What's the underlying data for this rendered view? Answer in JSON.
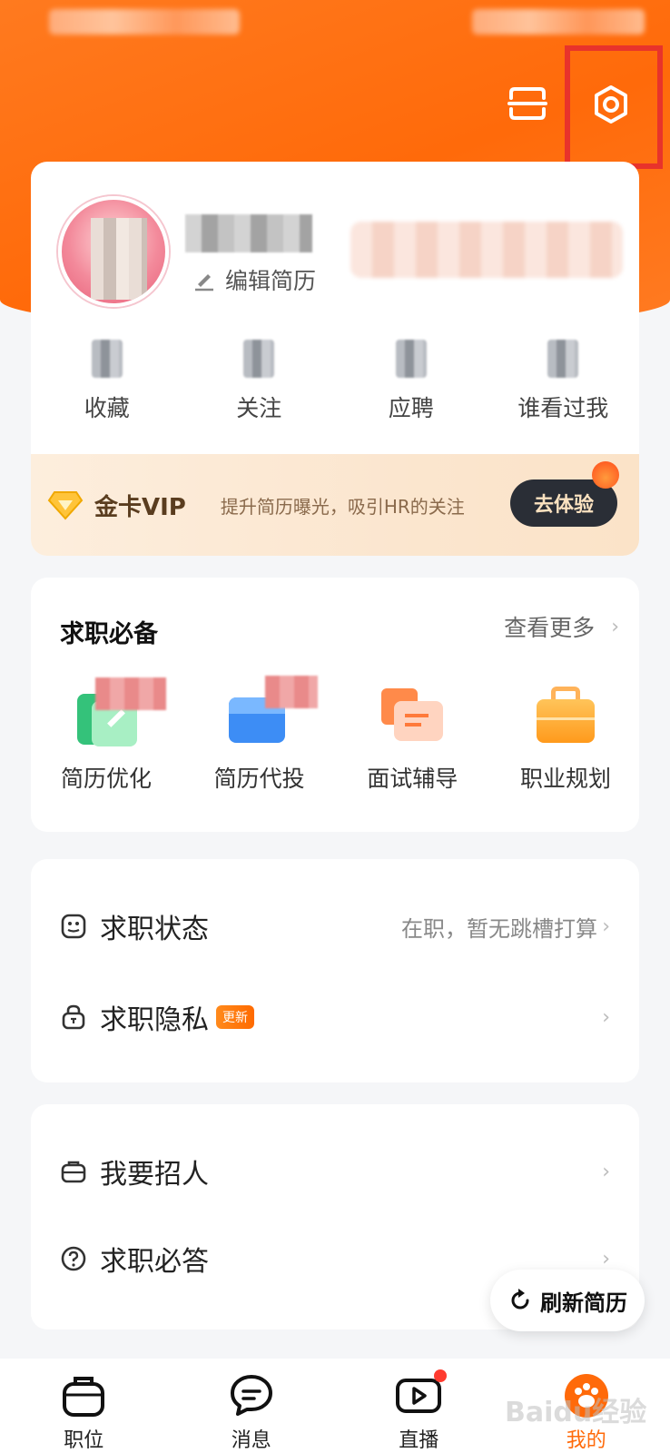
{
  "profile": {
    "edit_resume": "编辑简历",
    "stats": [
      "收藏",
      "关注",
      "应聘",
      "谁看过我"
    ],
    "vip": {
      "title": "金卡VIP",
      "description": "提升简历曝光，吸引HR的关注",
      "button": "去体验"
    }
  },
  "job_essentials": {
    "title": "求职必备",
    "more": "查看更多",
    "tools": [
      "简历优化",
      "简历代投",
      "面试辅导",
      "职业规划"
    ]
  },
  "settings_list": {
    "job_status_label": "求职状态",
    "job_status_value": "在职，暂无跳槽打算",
    "privacy_label": "求职隐私",
    "privacy_badge": "更新"
  },
  "other_list": {
    "recruit_label": "我要招人",
    "faq_label": "求职必答"
  },
  "refresh_button": "刷新简历",
  "tabbar": {
    "items": [
      "职位",
      "消息",
      "直播",
      "我的"
    ]
  },
  "watermark": "Baidu经验",
  "colors": {
    "brand_orange": "#ff6a0a",
    "highlight_red": "#e8332b"
  }
}
